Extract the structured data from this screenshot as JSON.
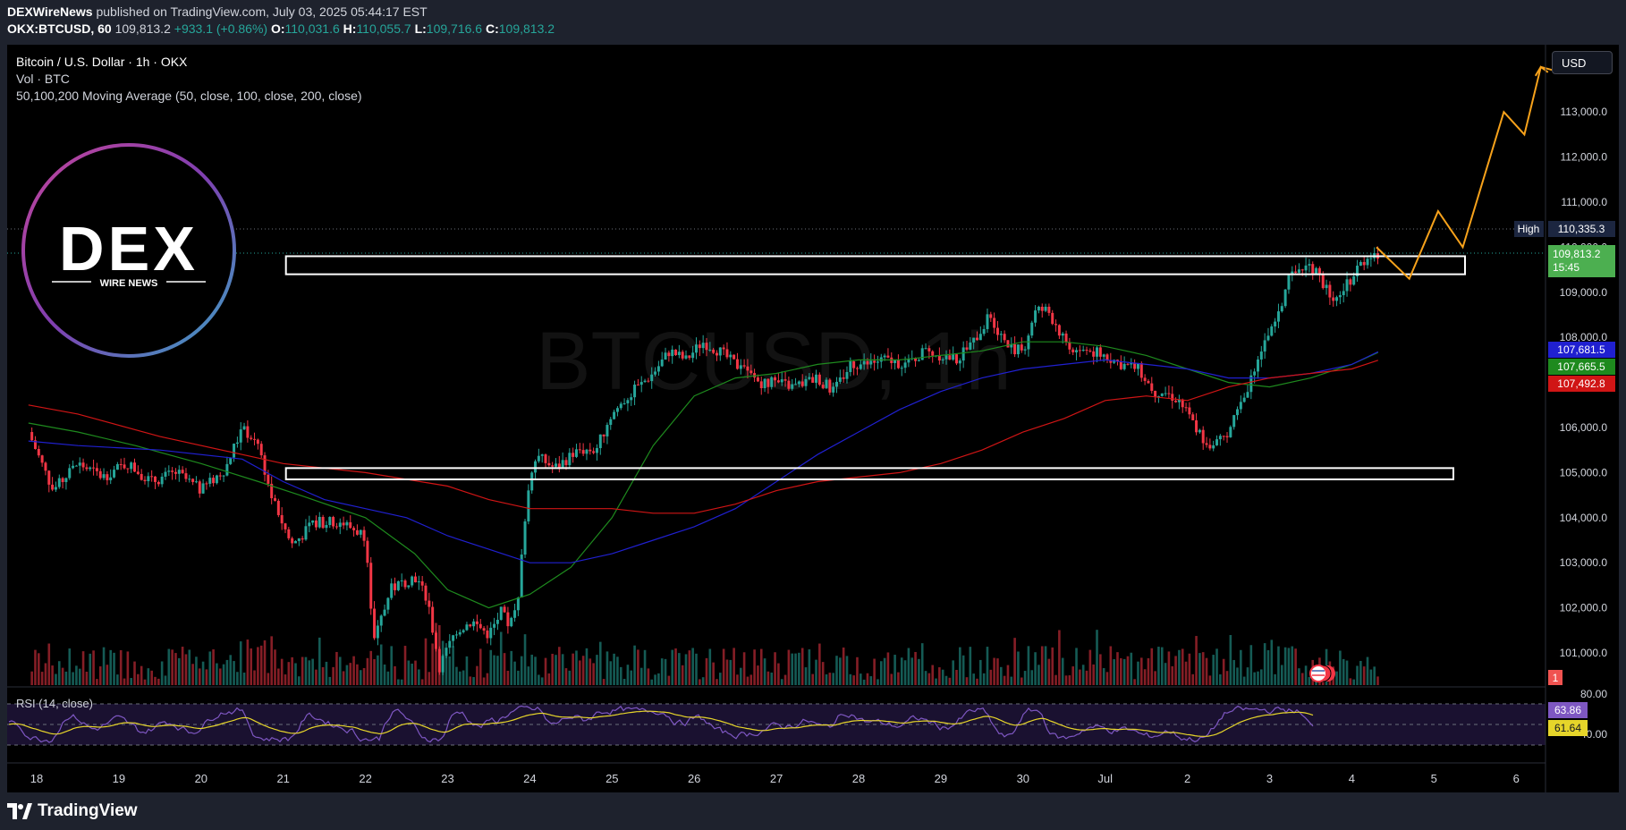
{
  "header": {
    "publisher": "DEXWireNews",
    "published_text": "published on TradingView.com, July 03, 2025 05:44:17 EST",
    "symbol": "OKX:BTCUSD, 60",
    "price": "109,813.2",
    "change": "+933.1 (+0.86%)",
    "o_label": "O:",
    "o_value": "110,031.6",
    "h_label": "H:",
    "h_value": "110,055.7",
    "l_label": "L:",
    "l_value": "109,716.6",
    "c_label": "C:",
    "c_value": "109,813.2"
  },
  "legend": {
    "title": "Bitcoin / U.S. Dollar · 1h · OKX",
    "volume": "Vol · BTC",
    "ma": "50,100,200 Moving Average (50, close, 100, close, 200, close)",
    "rsi": "RSI (14, close)"
  },
  "watermark": "BTCUSD, 1h",
  "logo": {
    "main": "DEX",
    "sub": "WIRE NEWS"
  },
  "currency_button": "USD",
  "price_axis": {
    "ticks": [
      "113,000.0",
      "112,000.0",
      "111,000.0",
      "110,000.0",
      "109,000.0",
      "108,000.0",
      "106,000.0",
      "105,000.0",
      "104,000.0",
      "103,000.0",
      "102,000.0",
      "101,000.0"
    ],
    "high_label": "High",
    "high_value": "110,335.3",
    "last_value": "109,813.2",
    "countdown": "15:45",
    "ma_values": [
      "107,681.5",
      "107,665.5",
      "107,492.8"
    ],
    "vol_flag": "1"
  },
  "rsi_axis": {
    "upper": "80.00",
    "rsi_value": "63.86",
    "ma_value": "61.64",
    "lower": "40.00"
  },
  "time_axis": [
    "18",
    "19",
    "20",
    "21",
    "22",
    "23",
    "24",
    "25",
    "26",
    "27",
    "28",
    "29",
    "30",
    "Jul",
    "2",
    "3",
    "4",
    "5",
    "6"
  ],
  "footer": {
    "brand": "TradingView"
  },
  "colors": {
    "up": "#26a69a",
    "down": "#f23645",
    "ma50": "#1e8a1e",
    "ma100": "#2020d0",
    "ma200": "#d01515",
    "projection": "#f7a21b",
    "rsi": "#7e57c2",
    "rsi_ma": "#e6d52a"
  },
  "chart_data": {
    "type": "candlestick",
    "title": "Bitcoin / U.S. Dollar · 1h · OKX",
    "ylim": [
      100500,
      114000
    ],
    "x_dates": [
      "18",
      "19",
      "20",
      "21",
      "22",
      "23",
      "24",
      "25",
      "26",
      "27",
      "28",
      "29",
      "30",
      "Jul",
      "2",
      "3",
      "4",
      "5",
      "6"
    ],
    "close_path": [
      [
        17.9,
        105900
      ],
      [
        18.2,
        104600
      ],
      [
        18.5,
        105200
      ],
      [
        18.8,
        104900
      ],
      [
        19.1,
        105200
      ],
      [
        19.4,
        104800
      ],
      [
        19.7,
        105000
      ],
      [
        20.0,
        104600
      ],
      [
        20.3,
        105100
      ],
      [
        20.5,
        106000
      ],
      [
        20.7,
        105600
      ],
      [
        20.85,
        104500
      ],
      [
        21.1,
        103400
      ],
      [
        21.4,
        103900
      ],
      [
        21.7,
        103900
      ],
      [
        22.0,
        103600
      ],
      [
        22.1,
        101200
      ],
      [
        22.3,
        102400
      ],
      [
        22.6,
        102700
      ],
      [
        22.75,
        102200
      ],
      [
        22.9,
        100700
      ],
      [
        23.1,
        101500
      ],
      [
        23.3,
        101700
      ],
      [
        23.5,
        101400
      ],
      [
        23.65,
        101900
      ],
      [
        23.75,
        101600
      ],
      [
        23.85,
        102000
      ],
      [
        23.95,
        104200
      ],
      [
        24.05,
        105400
      ],
      [
        24.3,
        105100
      ],
      [
        24.6,
        105500
      ],
      [
        24.8,
        105500
      ],
      [
        25.0,
        106300
      ],
      [
        25.2,
        106700
      ],
      [
        25.5,
        107200
      ],
      [
        25.7,
        107700
      ],
      [
        25.9,
        107500
      ],
      [
        26.1,
        107900
      ],
      [
        26.3,
        107700
      ],
      [
        26.5,
        107400
      ],
      [
        26.8,
        107000
      ],
      [
        27.0,
        107000
      ],
      [
        27.2,
        106900
      ],
      [
        27.5,
        107100
      ],
      [
        27.7,
        106800
      ],
      [
        27.9,
        107400
      ],
      [
        28.1,
        107400
      ],
      [
        28.3,
        107500
      ],
      [
        28.6,
        107400
      ],
      [
        28.8,
        107700
      ],
      [
        29.0,
        107600
      ],
      [
        29.2,
        107500
      ],
      [
        29.4,
        107900
      ],
      [
        29.6,
        108500
      ],
      [
        29.8,
        107800
      ],
      [
        30.0,
        107700
      ],
      [
        30.15,
        108600
      ],
      [
        30.3,
        108600
      ],
      [
        30.45,
        108100
      ],
      [
        30.6,
        107700
      ],
      [
        30.8,
        107700
      ],
      [
        31.0,
        107600
      ],
      [
        31.2,
        107400
      ],
      [
        31.4,
        107300
      ],
      [
        31.6,
        106800
      ],
      [
        31.7,
        106800
      ],
      [
        31.9,
        106600
      ],
      [
        32.1,
        106000
      ],
      [
        32.3,
        105500
      ],
      [
        32.45,
        105800
      ],
      [
        32.55,
        106100
      ],
      [
        32.7,
        106700
      ],
      [
        32.8,
        107300
      ],
      [
        32.95,
        107900
      ],
      [
        33.1,
        108400
      ],
      [
        33.2,
        109200
      ],
      [
        33.35,
        109500
      ],
      [
        33.5,
        109600
      ],
      [
        33.65,
        109200
      ],
      [
        33.8,
        108800
      ],
      [
        33.95,
        109200
      ],
      [
        34.1,
        109600
      ],
      [
        34.25,
        109900
      ],
      [
        34.32,
        109800
      ]
    ],
    "moving_averages": [
      {
        "period": 50,
        "values": [
          [
            17.9,
            106100
          ],
          [
            18.5,
            105900
          ],
          [
            19.2,
            105600
          ],
          [
            20.0,
            105200
          ],
          [
            20.7,
            104800
          ],
          [
            21.2,
            104500
          ],
          [
            22.0,
            104000
          ],
          [
            22.6,
            103200
          ],
          [
            23.0,
            102400
          ],
          [
            23.5,
            102000
          ],
          [
            24.0,
            102300
          ],
          [
            24.5,
            102900
          ],
          [
            25.0,
            104000
          ],
          [
            25.5,
            105600
          ],
          [
            26.0,
            106700
          ],
          [
            26.5,
            107100
          ],
          [
            27.0,
            107200
          ],
          [
            27.5,
            107400
          ],
          [
            28.0,
            107500
          ],
          [
            28.5,
            107500
          ],
          [
            29.0,
            107600
          ],
          [
            29.5,
            107700
          ],
          [
            30.0,
            107900
          ],
          [
            30.5,
            107900
          ],
          [
            31.0,
            107800
          ],
          [
            31.5,
            107600
          ],
          [
            32.0,
            107300
          ],
          [
            32.5,
            107000
          ],
          [
            33.0,
            106900
          ],
          [
            33.5,
            107100
          ],
          [
            34.0,
            107400
          ],
          [
            34.32,
            107665
          ]
        ]
      },
      {
        "period": 100,
        "values": [
          [
            17.9,
            105700
          ],
          [
            18.5,
            105600
          ],
          [
            19.5,
            105500
          ],
          [
            20.5,
            105300
          ],
          [
            21.0,
            104800
          ],
          [
            21.5,
            104400
          ],
          [
            22.0,
            104200
          ],
          [
            22.5,
            104000
          ],
          [
            23.0,
            103600
          ],
          [
            23.5,
            103300
          ],
          [
            24.0,
            103000
          ],
          [
            24.5,
            103000
          ],
          [
            25.0,
            103200
          ],
          [
            25.5,
            103500
          ],
          [
            26.0,
            103800
          ],
          [
            26.5,
            104200
          ],
          [
            27.0,
            104800
          ],
          [
            27.5,
            105400
          ],
          [
            28.0,
            105900
          ],
          [
            28.5,
            106400
          ],
          [
            29.0,
            106800
          ],
          [
            29.5,
            107100
          ],
          [
            30.0,
            107300
          ],
          [
            30.5,
            107400
          ],
          [
            31.0,
            107500
          ],
          [
            31.5,
            107400
          ],
          [
            32.0,
            107300
          ],
          [
            32.5,
            107100
          ],
          [
            33.0,
            107100
          ],
          [
            33.5,
            107200
          ],
          [
            34.0,
            107400
          ],
          [
            34.32,
            107681
          ]
        ]
      },
      {
        "period": 200,
        "values": [
          [
            17.9,
            106500
          ],
          [
            18.5,
            106300
          ],
          [
            19.5,
            105800
          ],
          [
            20.5,
            105400
          ],
          [
            21.0,
            105200
          ],
          [
            21.5,
            105100
          ],
          [
            22.0,
            105000
          ],
          [
            23.0,
            104700
          ],
          [
            23.5,
            104400
          ],
          [
            24.0,
            104200
          ],
          [
            25.0,
            104200
          ],
          [
            25.5,
            104100
          ],
          [
            26.0,
            104100
          ],
          [
            26.5,
            104300
          ],
          [
            27.0,
            104600
          ],
          [
            27.5,
            104800
          ],
          [
            28.0,
            104900
          ],
          [
            28.5,
            105000
          ],
          [
            29.0,
            105200
          ],
          [
            29.5,
            105500
          ],
          [
            30.0,
            105900
          ],
          [
            30.5,
            106200
          ],
          [
            31.0,
            106600
          ],
          [
            31.5,
            106700
          ],
          [
            32.0,
            106600
          ],
          [
            32.5,
            106900
          ],
          [
            33.0,
            107100
          ],
          [
            33.5,
            107200
          ],
          [
            34.0,
            107300
          ],
          [
            34.32,
            107493
          ]
        ]
      }
    ],
    "zones": [
      {
        "x": [
          21.0,
          38.8
        ],
        "y": [
          109400,
          109800
        ]
      },
      {
        "x": [
          21.0,
          38.8
        ],
        "y": [
          104850,
          105100
        ]
      }
    ],
    "projection": [
      [
        34.3,
        110000
      ],
      [
        34.7,
        109300
      ],
      [
        35.05,
        110800
      ],
      [
        35.35,
        110000
      ],
      [
        35.85,
        113000
      ],
      [
        36.1,
        112500
      ],
      [
        36.3,
        114000
      ],
      [
        36.5,
        113900
      ]
    ],
    "rsi": {
      "upper": 70,
      "lower": 30,
      "last": 63.86,
      "ma_last": 61.64
    }
  }
}
